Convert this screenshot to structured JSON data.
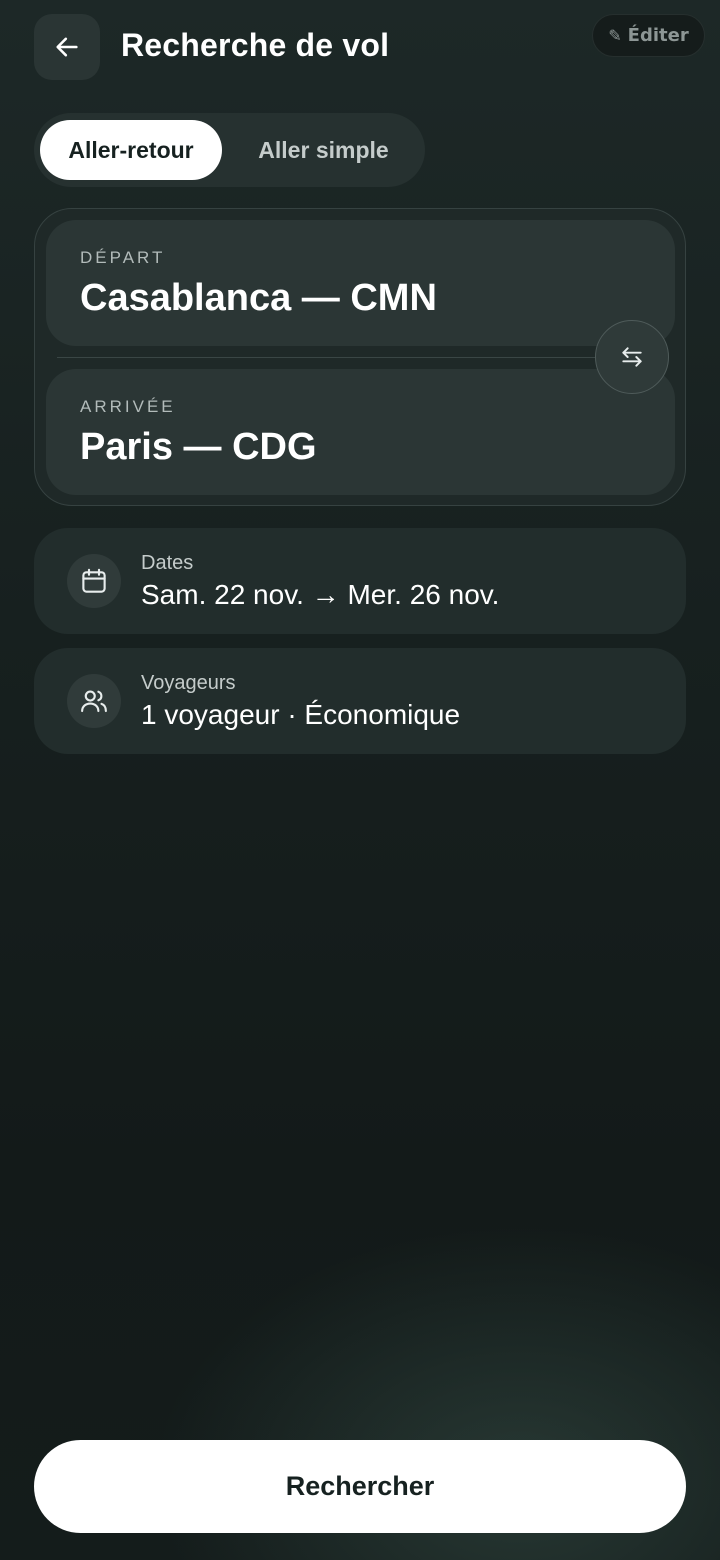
{
  "header": {
    "title": "Recherche de vol",
    "edit_label": "Éditer",
    "back_icon": "arrow-left-icon",
    "edit_icon": "pencil-icon"
  },
  "trip_type": {
    "options": [
      "Aller-retour",
      "Aller simple"
    ],
    "selected": "Aller-retour"
  },
  "route": {
    "departure_label": "DÉPART",
    "departure_value": "Casablanca — CMN",
    "arrival_label": "ARRIVÉE",
    "arrival_value": "Paris — CDG",
    "swap_icon": "swap-arrows-icon"
  },
  "dates": {
    "label": "Dates",
    "value": "Sam. 22 nov. → Mer. 26 nov.",
    "icon": "calendar-icon"
  },
  "travelers": {
    "label": "Voyageurs",
    "value": "1 voyageur · Économique",
    "icon": "users-icon"
  },
  "actions": {
    "search_label": "Rechercher"
  },
  "colors": {
    "background": "#17201f",
    "surface": "#2b3635",
    "primary_button": "#ffffff",
    "primary_text": "#162120"
  }
}
